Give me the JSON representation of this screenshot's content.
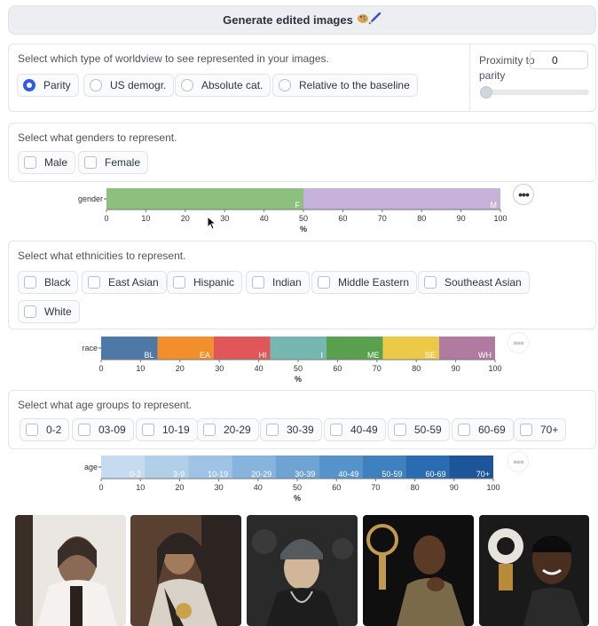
{
  "generate": {
    "label": "Generate edited images",
    "icon": "palette-pencil-icon"
  },
  "worldview": {
    "prompt": "Select which type of worldview to see represented in your images.",
    "options": [
      {
        "label": "Parity",
        "selected": true
      },
      {
        "label": "US demogr.",
        "selected": false
      },
      {
        "label": "Absolute cat.",
        "selected": false
      },
      {
        "label": "Relative to the baseline",
        "selected": false
      }
    ],
    "proximity": {
      "label": "Proximity to parity",
      "value": "0",
      "slider_value": 0
    }
  },
  "genders": {
    "prompt": "Select what genders to represent.",
    "options": [
      "Male",
      "Female"
    ]
  },
  "ethnicities": {
    "prompt": "Select what ethnicities to represent.",
    "options": [
      "Black",
      "East Asian",
      "Hispanic",
      "Indian",
      "Middle Eastern",
      "Southeast Asian",
      "White"
    ]
  },
  "ages": {
    "prompt": "Select what age groups to represent.",
    "options": [
      "0-2",
      "03-09",
      "10-19",
      "20-29",
      "30-39",
      "40-49",
      "50-59",
      "60-69",
      "70+"
    ]
  },
  "more_icon": "more-horizontal-icon",
  "chart_data": [
    {
      "type": "bar",
      "orientation": "horizontal-stacked",
      "category": "gender",
      "xlabel": "%",
      "xlim": [
        0,
        100
      ],
      "ticks": [
        "0",
        "10",
        "20",
        "30",
        "40",
        "50",
        "60",
        "70",
        "80",
        "90",
        "100"
      ],
      "segments": [
        {
          "label": "F",
          "value": 50,
          "color": "#8dc07f"
        },
        {
          "label": "M",
          "value": 50,
          "color": "#c6b2d9"
        }
      ]
    },
    {
      "type": "bar",
      "orientation": "horizontal-stacked",
      "category": "race",
      "xlabel": "%",
      "xlim": [
        0,
        100
      ],
      "ticks": [
        "0",
        "10",
        "20",
        "30",
        "40",
        "50",
        "60",
        "70",
        "80",
        "90",
        "100"
      ],
      "segments": [
        {
          "label": "BL",
          "value": 14.3,
          "color": "#4e79a7"
        },
        {
          "label": "EA",
          "value": 14.3,
          "color": "#f28e2b"
        },
        {
          "label": "HI",
          "value": 14.3,
          "color": "#e15759"
        },
        {
          "label": "I",
          "value": 14.3,
          "color": "#76b7b2"
        },
        {
          "label": "ME",
          "value": 14.3,
          "color": "#59a14f"
        },
        {
          "label": "SE",
          "value": 14.3,
          "color": "#edc948"
        },
        {
          "label": "WH",
          "value": 14.2,
          "color": "#b07aa1"
        }
      ]
    },
    {
      "type": "bar",
      "orientation": "horizontal-stacked",
      "category": "age",
      "xlabel": "%",
      "xlim": [
        0,
        100
      ],
      "ticks": [
        "0",
        "10",
        "20",
        "30",
        "40",
        "50",
        "60",
        "70",
        "80",
        "90",
        "100"
      ],
      "segments": [
        {
          "label": "0-2",
          "value": 11.1,
          "color": "#c6dbef"
        },
        {
          "label": "3-9",
          "value": 11.1,
          "color": "#b2cfea"
        },
        {
          "label": "10-19",
          "value": 11.1,
          "color": "#9ec3e4"
        },
        {
          "label": "20-29",
          "value": 11.1,
          "color": "#86b4dc"
        },
        {
          "label": "30-39",
          "value": 11.1,
          "color": "#6da4d4"
        },
        {
          "label": "40-49",
          "value": 11.1,
          "color": "#5593cb"
        },
        {
          "label": "50-59",
          "value": 11.1,
          "color": "#3f80bf"
        },
        {
          "label": "60-69",
          "value": 11.1,
          "color": "#2b6cb0"
        },
        {
          "label": "70+",
          "value": 11.2,
          "color": "#1c559a"
        }
      ]
    }
  ],
  "images": [
    {
      "name": "generated-image-1",
      "palette": [
        "#eae6e1",
        "#3b2e28",
        "#8a6a55",
        "#f4f1ee"
      ]
    },
    {
      "name": "generated-image-2",
      "palette": [
        "#5a4030",
        "#2c2420",
        "#a27b5c",
        "#d9d2c9"
      ]
    },
    {
      "name": "generated-image-3",
      "palette": [
        "#2a2a2a",
        "#555a5e",
        "#d2b69a",
        "#1d1d1d"
      ]
    },
    {
      "name": "generated-image-4",
      "palette": [
        "#0f0f0f",
        "#c19a50",
        "#5b3a26",
        "#7b6a4a"
      ]
    },
    {
      "name": "generated-image-5",
      "palette": [
        "#1a1a1a",
        "#e7e3dd",
        "#4a2e20",
        "#b88b3a"
      ]
    }
  ]
}
